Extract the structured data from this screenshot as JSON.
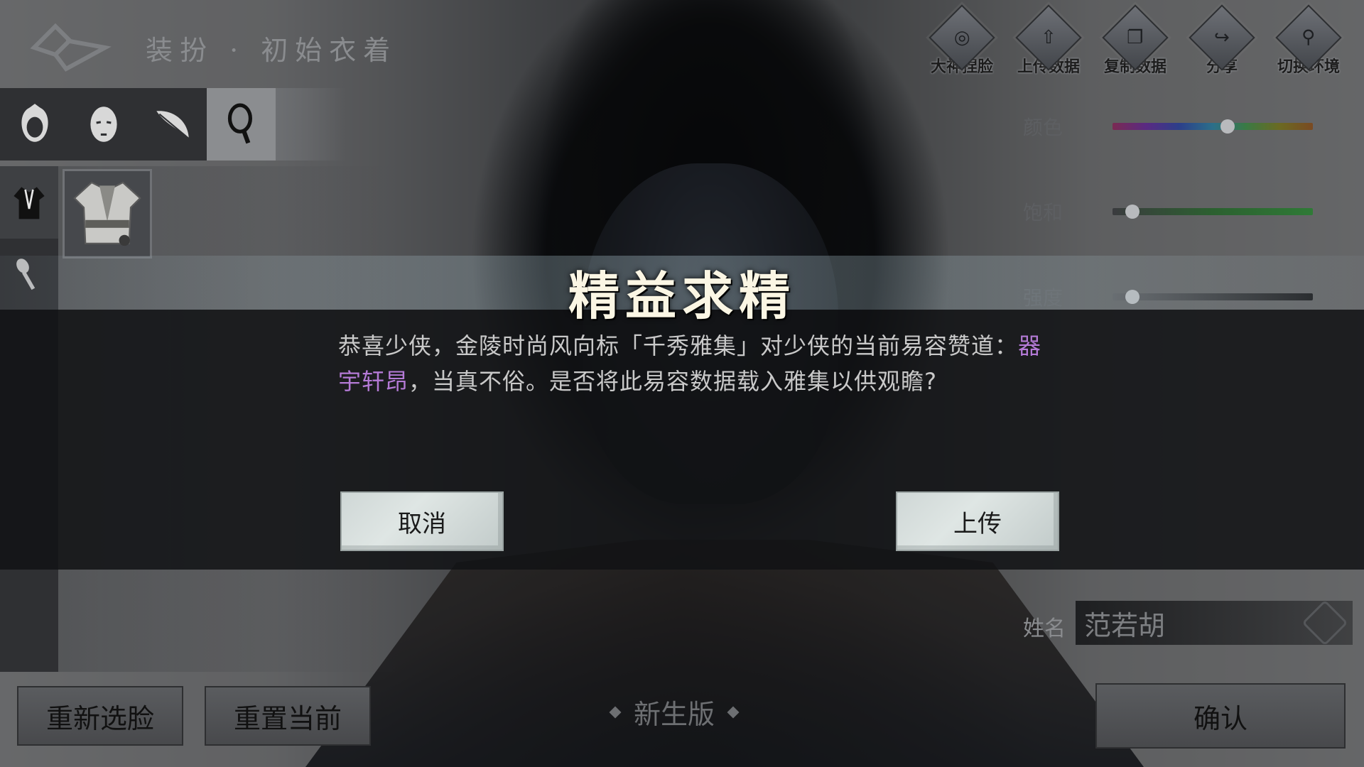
{
  "header": {
    "title": "装扮 · 初始衣着",
    "top_buttons": [
      {
        "label": "大神捏脸",
        "icon": "magnify-face-icon"
      },
      {
        "label": "上传数据",
        "icon": "upload-icon"
      },
      {
        "label": "复制数据",
        "icon": "copy-icon"
      },
      {
        "label": "分享",
        "icon": "share-icon"
      },
      {
        "label": "切换环境",
        "icon": "search-icon"
      }
    ]
  },
  "category_tabs": [
    {
      "icon": "hairstyle-icon",
      "active": false
    },
    {
      "icon": "face-icon",
      "active": false
    },
    {
      "icon": "feather-icon",
      "active": false
    },
    {
      "icon": "mirror-icon",
      "active": true
    }
  ],
  "side_tabs": [
    {
      "icon": "robe-icon",
      "active": true
    },
    {
      "icon": "brush-icon",
      "active": false
    }
  ],
  "sliders": [
    {
      "label": "颜色",
      "value": 0.58,
      "style": "color"
    },
    {
      "label": "饱和",
      "value": 0.07,
      "style": "sat"
    },
    {
      "label": "强度",
      "value": 0.07,
      "style": "str"
    }
  ],
  "name": {
    "label": "姓名",
    "value": "范若胡"
  },
  "bottom": {
    "reselect": "重新选脸",
    "reset": "重置当前",
    "edition": "新生版",
    "confirm": "确认"
  },
  "dialog": {
    "title": "精益求精",
    "msg_prefix": "恭喜少侠，金陵时尚风向标「千秀雅集」对少侠的当前易容赞道：",
    "msg_highlight": "器宇轩昂",
    "msg_suffix": "，当真不俗。是否将此易容数据载入雅集以供观瞻?",
    "cancel": "取消",
    "upload": "上传"
  },
  "colors": {
    "highlight": "#b47ad6",
    "dialog_bg": "#121315"
  }
}
